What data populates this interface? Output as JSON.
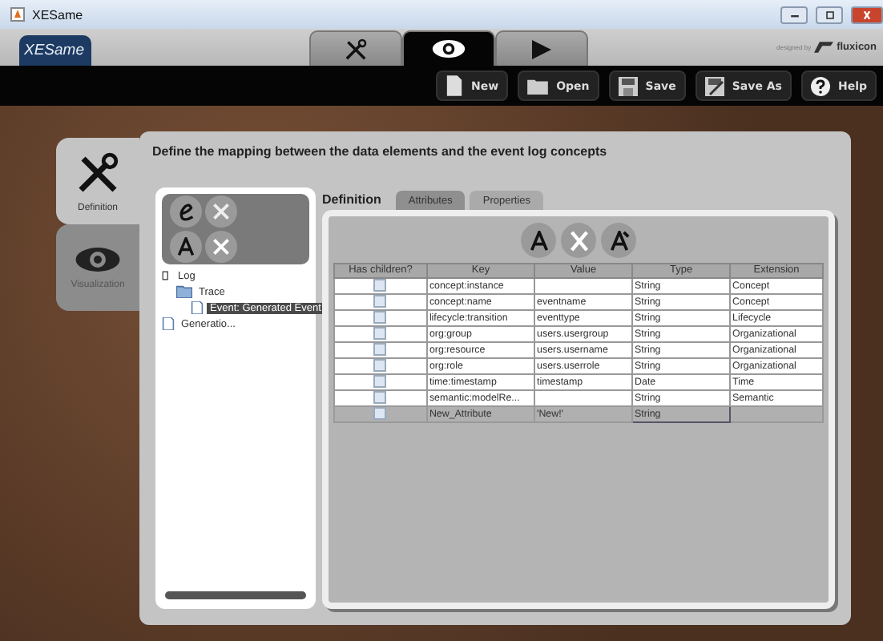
{
  "window": {
    "title": "XESame"
  },
  "logo": "XESame",
  "mode_tabs": [
    {
      "kind": "tools",
      "selected": false
    },
    {
      "kind": "eye",
      "selected": true
    },
    {
      "kind": "play",
      "selected": false
    }
  ],
  "credit": {
    "prefix": "designed by",
    "brand": "fluxicon"
  },
  "toolbar": [
    {
      "kind": "new",
      "label": "New"
    },
    {
      "kind": "open",
      "label": "Open"
    },
    {
      "kind": "save",
      "label": "Save"
    },
    {
      "kind": "saveas",
      "label": "Save As"
    },
    {
      "kind": "help",
      "label": "Help"
    }
  ],
  "side_tabs": [
    {
      "kind": "tools",
      "label": "Definition",
      "selected": true
    },
    {
      "kind": "eye",
      "label": "Visualization",
      "selected": false
    }
  ],
  "heading": "Define the mapping between the data elements and the event log concepts",
  "tree": [
    {
      "label": "Log",
      "kind": "log",
      "selected": false,
      "children": [
        {
          "label": "Trace",
          "kind": "folder",
          "selected": false,
          "children": [
            {
              "label": "Event: Generated Event",
              "kind": "doc",
              "selected": true
            }
          ]
        }
      ]
    },
    {
      "label": "Generatio...",
      "kind": "doc",
      "selected": false
    }
  ],
  "definition_label": "Definition",
  "tabs": [
    {
      "label": "Attributes",
      "selected": true
    },
    {
      "label": "Properties",
      "selected": false
    }
  ],
  "table": {
    "columns": [
      "Has children?",
      "Key",
      "Value",
      "Type",
      "Extension"
    ],
    "rows": [
      {
        "checked": false,
        "selected": false,
        "cells": [
          "",
          "concept:instance",
          "",
          "String",
          "Concept"
        ]
      },
      {
        "checked": false,
        "selected": false,
        "cells": [
          "",
          "concept:name",
          "eventname",
          "String",
          "Concept"
        ]
      },
      {
        "checked": false,
        "selected": false,
        "cells": [
          "",
          "lifecycle:transition",
          "eventtype",
          "String",
          "Lifecycle"
        ]
      },
      {
        "checked": false,
        "selected": false,
        "cells": [
          "",
          "org:group",
          "users.usergroup",
          "String",
          "Organizational"
        ]
      },
      {
        "checked": false,
        "selected": false,
        "cells": [
          "",
          "org:resource",
          "users.username",
          "String",
          "Organizational"
        ]
      },
      {
        "checked": false,
        "selected": false,
        "cells": [
          "",
          "org:role",
          "users.userrole",
          "String",
          "Organizational"
        ]
      },
      {
        "checked": false,
        "selected": false,
        "cells": [
          "",
          "time:timestamp",
          "timestamp",
          "Date",
          "Time"
        ]
      },
      {
        "checked": false,
        "selected": false,
        "cells": [
          "",
          "semantic:modelRe...",
          "",
          "String",
          "Semantic"
        ]
      },
      {
        "checked": false,
        "selected": true,
        "cells": [
          "",
          "New_Attribute",
          "'New!'",
          "String",
          ""
        ]
      }
    ]
  }
}
